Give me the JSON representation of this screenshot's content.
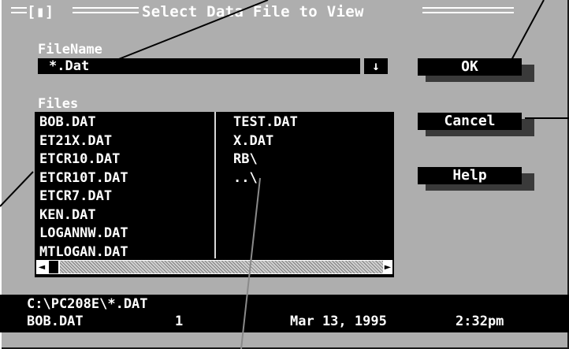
{
  "dialog": {
    "title": "Select Data File to View",
    "system_menu": "[▮]"
  },
  "filename": {
    "label": "FileName",
    "value": "*.Dat",
    "dropdown_icon": "↓"
  },
  "files": {
    "label": "Files",
    "column1": [
      "BOB.DAT",
      "ET21X.DAT",
      "ETCR10.DAT",
      "ETCR10T.DAT",
      "ETCR7.DAT",
      "KEN.DAT",
      "LOGANNW.DAT",
      "MTLOGAN.DAT"
    ],
    "column2": [
      "TEST.DAT",
      "X.DAT",
      "RB\\",
      "..\\"
    ],
    "selected": "BOB.DAT",
    "scroll_left_icon": "◄",
    "scroll_right_icon": "►"
  },
  "buttons": {
    "ok": "OK",
    "cancel": "Cancel",
    "help": "Help"
  },
  "status": {
    "path": "C:\\PC208E\\*.DAT",
    "file": "BOB.DAT",
    "size": "1",
    "date": "Mar 13, 1995",
    "time": "2:32pm"
  },
  "colors": {
    "background": "#aeaeae",
    "field": "#000000",
    "text": "#ffffff"
  }
}
